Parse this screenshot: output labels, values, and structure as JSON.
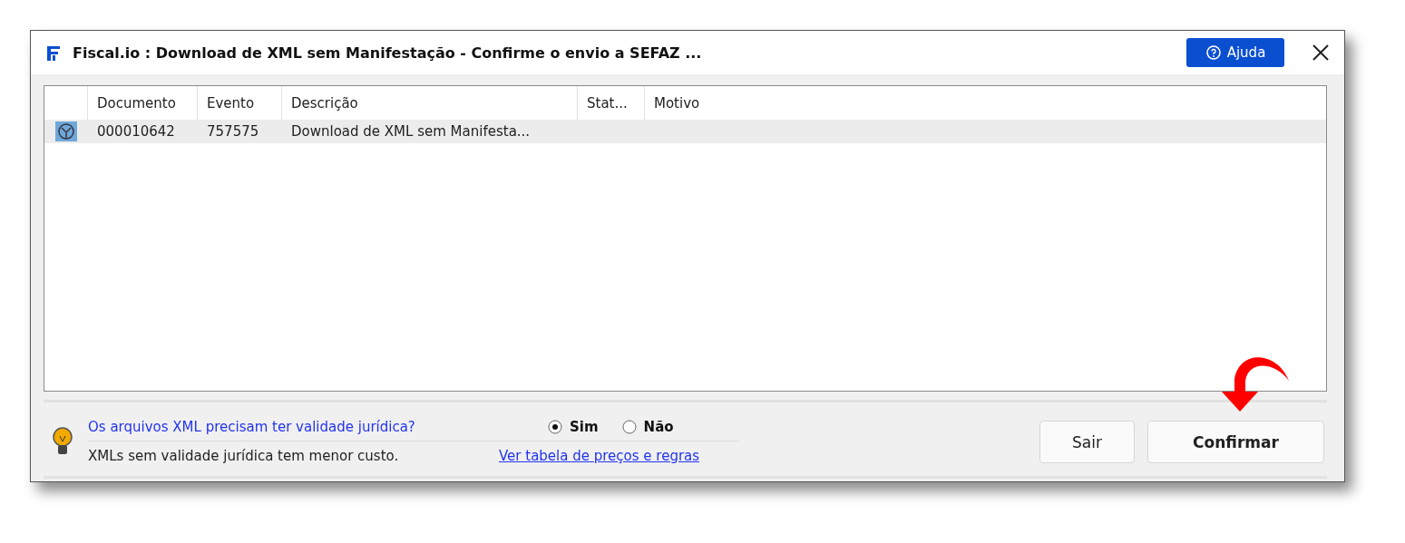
{
  "window": {
    "title": "Fiscal.io : Download de XML sem Manifestação - Confirme o envio a SEFAZ ...",
    "help_button": "Ajuda"
  },
  "table": {
    "columns": [
      "Documento",
      "Evento",
      "Descrição",
      "Stat...",
      "Motivo"
    ],
    "rows": [
      {
        "selected": true,
        "cells": [
          "000010642",
          "757575",
          "Download de XML sem Manifesta...",
          "",
          ""
        ]
      }
    ]
  },
  "footer": {
    "question": "Os arquivos XML precisam ter validade jurídica?",
    "options": [
      {
        "label": "Sim",
        "selected": true
      },
      {
        "label": "Não",
        "selected": false
      }
    ],
    "note": "XMLs sem validade jurídica tem menor custo.",
    "link": "Ver tabela de preços e regras",
    "buttons": [
      {
        "label": "Sair",
        "kind": "normal"
      },
      {
        "label": "Confirmar",
        "kind": "primary"
      }
    ]
  }
}
